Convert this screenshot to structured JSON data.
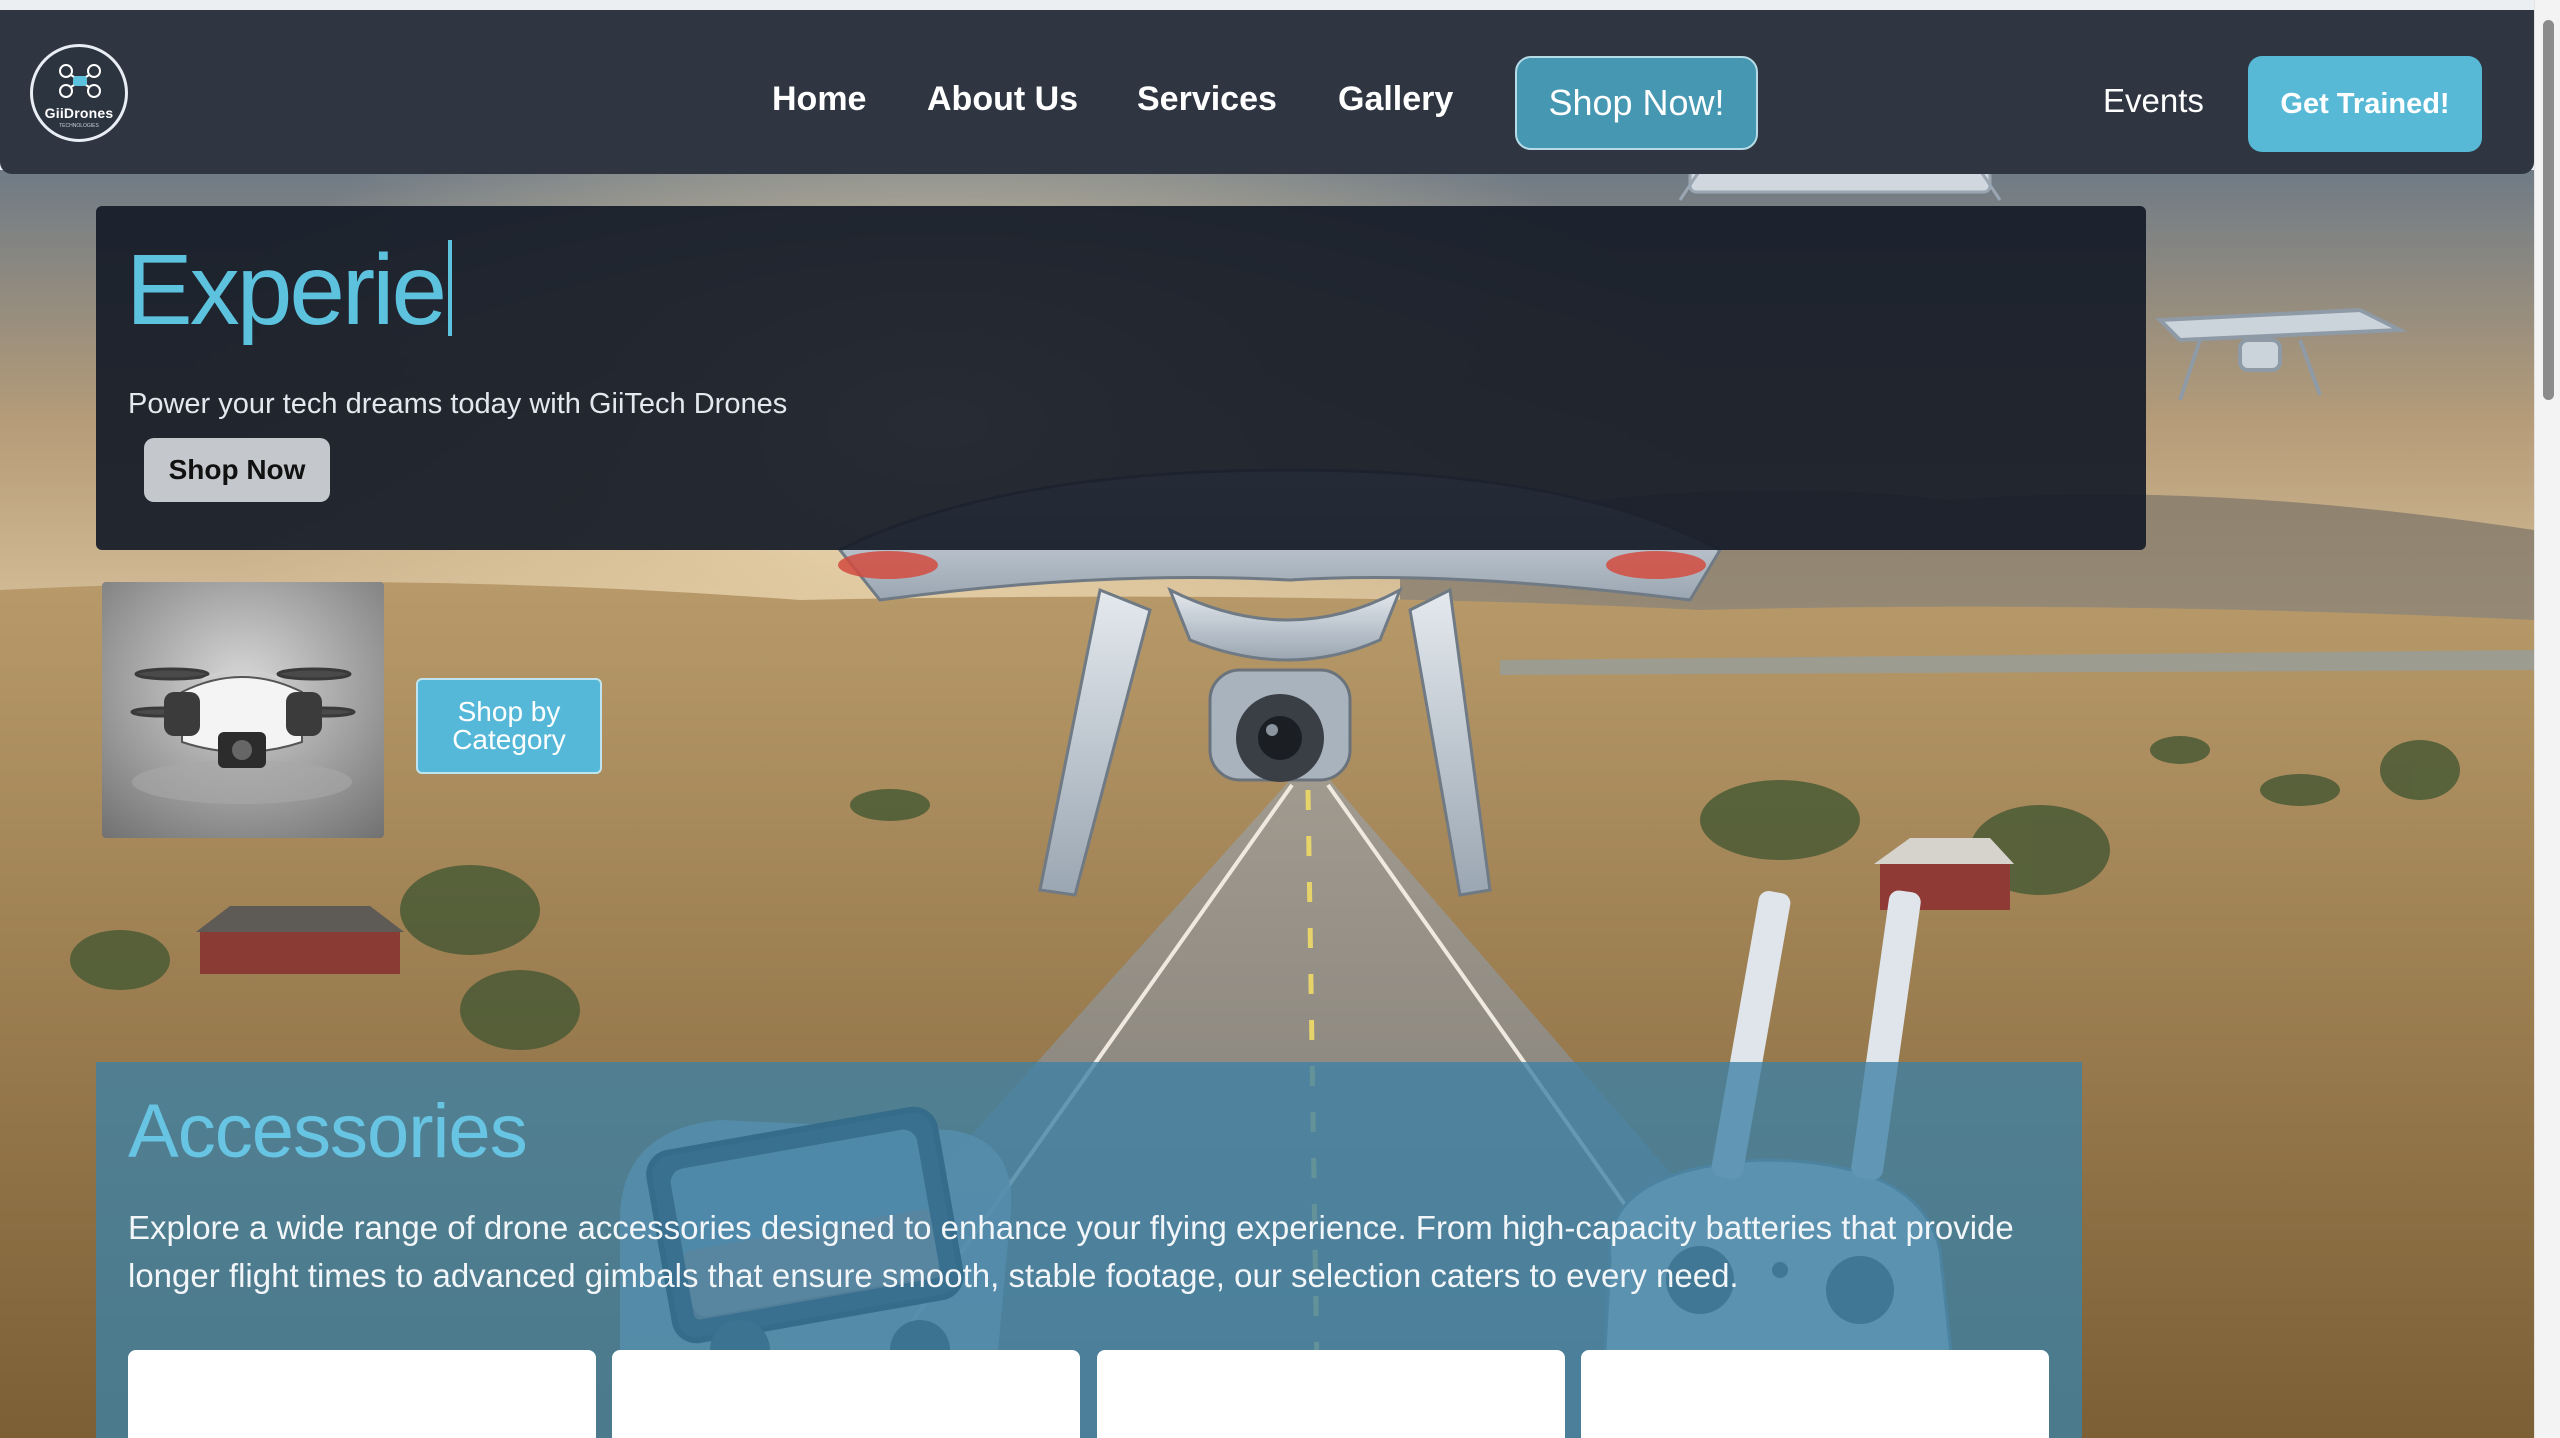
{
  "nav": {
    "logo_text": "GiiDrones",
    "logo_tagline": "TECHNOLOGIES",
    "links": [
      "Home",
      "About Us",
      "Services",
      "Gallery"
    ],
    "shop_button": "Shop Now!",
    "events": "Events",
    "trained_button": "Get Trained!"
  },
  "hero": {
    "heading_typed": "Experie",
    "subtitle": "Power your tech dreams today with GiiTech Drones",
    "shop_button": "Shop Now"
  },
  "category": {
    "button": "Shop by Category"
  },
  "accessories": {
    "title": "Accessories",
    "description": "Explore a wide range of drone accessories designed to enhance your flying experience. From high-capacity batteries that provide longer flight times to advanced gimbals that ensure smooth, stable footage, our selection caters to every need."
  },
  "colors": {
    "navbar": "#2f3642",
    "accent": "#5cc2de",
    "shop_button": "#4697b2",
    "trained_button": "#58b9d6"
  },
  "icons": {
    "logo": "drone-logo-icon",
    "product": "quadcopter-product-image"
  }
}
